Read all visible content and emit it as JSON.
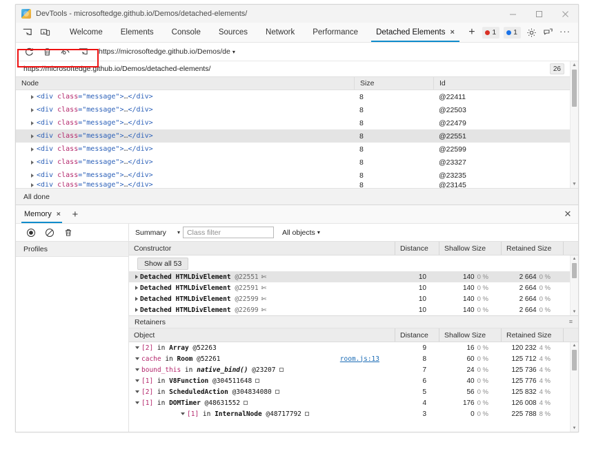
{
  "window": {
    "title": "DevTools - microsoftedge.github.io/Demos/detached-elements/",
    "favicon": "edge-devtools-icon",
    "controls": {
      "minimize": "minimize-icon",
      "maximize": "maximize-icon",
      "close": "close-icon"
    }
  },
  "main_tabs": {
    "left_icons": [
      "inspect-element-icon",
      "device-emulation-icon"
    ],
    "items": [
      {
        "label": "Welcome",
        "active": false
      },
      {
        "label": "Elements",
        "active": false
      },
      {
        "label": "Console",
        "active": false
      },
      {
        "label": "Sources",
        "active": false
      },
      {
        "label": "Network",
        "active": false
      },
      {
        "label": "Performance",
        "active": false
      },
      {
        "label": "Detached Elements",
        "active": true,
        "close": "×"
      }
    ],
    "add_tab": "+",
    "badges": [
      {
        "name": "error-badge",
        "count": "1",
        "color": "#d93025"
      },
      {
        "name": "info-badge",
        "count": "1",
        "color": "#1a73e8"
      }
    ],
    "right_icons": [
      "gear-icon",
      "feedback-icon"
    ],
    "more": "···"
  },
  "detached_toolbar": {
    "tools": [
      "refresh-icon",
      "delete-icon",
      "detach-eye-icon",
      "target-window-icon"
    ],
    "target": "https://microsoftedge.github.io/Demos/de",
    "caret": "▾",
    "annotation": "red-highlight-box"
  },
  "detached_panel": {
    "url": "https://microsoftedge.github.io/Demos/detached-elements/",
    "count": "26",
    "columns": [
      "Node",
      "Size",
      "Id"
    ],
    "rows": [
      {
        "node": "<div class=\"message\">…</div>",
        "size": "8",
        "id": "@22411",
        "selected": false
      },
      {
        "node": "<div class=\"message\">…</div>",
        "size": "8",
        "id": "@22503",
        "selected": false
      },
      {
        "node": "<div class=\"message\">…</div>",
        "size": "8",
        "id": "@22479",
        "selected": false
      },
      {
        "node": "<div class=\"message\">…</div>",
        "size": "8",
        "id": "@22551",
        "selected": true
      },
      {
        "node": "<div class=\"message\">…</div>",
        "size": "8",
        "id": "@22599",
        "selected": false
      },
      {
        "node": "<div class=\"message\">…</div>",
        "size": "8",
        "id": "@23327",
        "selected": false
      },
      {
        "node": "<div class=\"message\">…</div>",
        "size": "8",
        "id": "@23235",
        "selected": false
      },
      {
        "node": "<div class=\"message\">…</div>",
        "size": "8",
        "id": "@23145",
        "selected": false
      }
    ],
    "status": "All done"
  },
  "drawer": {
    "tabs": [
      {
        "label": "Memory",
        "active": true,
        "close": "×"
      }
    ],
    "add_tab": "+",
    "close": "✕"
  },
  "memory": {
    "toolbar_icons": [
      "record-icon",
      "clear-icon",
      "delete-icon"
    ],
    "view_select": "Summary",
    "view_caret": "▾",
    "class_filter_placeholder": "Class filter",
    "class_filter_value": "",
    "objects_select": "All objects",
    "objects_caret": "▾",
    "profiles_header": "Profiles",
    "constructor_columns": [
      "Constructor",
      "Distance",
      "Shallow Size",
      "Retained Size"
    ],
    "show_all_label": "Show all 53",
    "constructor_rows": [
      {
        "prefix": "Detached",
        "ctor": "HTMLDivElement",
        "id": "@22551",
        "distance": "10",
        "shallow": "140",
        "shallow_pct": "0 %",
        "retained": "2 664",
        "retained_pct": "0 %",
        "selected": true
      },
      {
        "prefix": "Detached",
        "ctor": "HTMLDivElement",
        "id": "@22591",
        "distance": "10",
        "shallow": "140",
        "shallow_pct": "0 %",
        "retained": "2 664",
        "retained_pct": "0 %",
        "selected": false
      },
      {
        "prefix": "Detached",
        "ctor": "HTMLDivElement",
        "id": "@22599",
        "distance": "10",
        "shallow": "140",
        "shallow_pct": "0 %",
        "retained": "2 664",
        "retained_pct": "0 %",
        "selected": false
      },
      {
        "prefix": "Detached",
        "ctor": "HTMLDivElement",
        "id": "@22699",
        "distance": "10",
        "shallow": "140",
        "shallow_pct": "0 %",
        "retained": "2 664",
        "retained_pct": "0 %",
        "selected": false
      }
    ],
    "retainers_label": "Retainers",
    "retainers_columns": [
      "Object",
      "Distance",
      "Shallow Size",
      "Retained Size"
    ],
    "retainer_rows": [
      {
        "indent": 0,
        "index": "[2]",
        "in": "in",
        "name": "Array",
        "id": "@52263",
        "link": "",
        "distance": "9",
        "shallow": "16",
        "shallow_pct": "0 %",
        "retained": "120 232",
        "retained_pct": "4 %",
        "italic": false,
        "box": false
      },
      {
        "indent": 1,
        "index": "cache",
        "in": "in",
        "name": "Room",
        "id": "@52261",
        "link": "room.js:13",
        "distance": "8",
        "shallow": "60",
        "shallow_pct": "0 %",
        "retained": "125 712",
        "retained_pct": "4 %",
        "italic": false,
        "box": false
      },
      {
        "indent": 2,
        "index": "bound_this",
        "in": "in",
        "name": "native_bind()",
        "id": "@23207",
        "link": "",
        "distance": "7",
        "shallow": "24",
        "shallow_pct": "0 %",
        "retained": "125 736",
        "retained_pct": "4 %",
        "italic": true,
        "box": true
      },
      {
        "indent": 3,
        "index": "[1]",
        "in": "in",
        "name": "V8Function",
        "id": "@304511648",
        "link": "",
        "distance": "6",
        "shallow": "40",
        "shallow_pct": "0 %",
        "retained": "125 776",
        "retained_pct": "4 %",
        "italic": false,
        "box": true
      },
      {
        "indent": 4,
        "index": "[2]",
        "in": "in",
        "name": "ScheduledAction",
        "id": "@304834080",
        "link": "",
        "distance": "5",
        "shallow": "56",
        "shallow_pct": "0 %",
        "retained": "125 832",
        "retained_pct": "4 %",
        "italic": false,
        "box": true
      },
      {
        "indent": 5,
        "index": "[1]",
        "in": "in",
        "name": "DOMTimer",
        "id": "@48631552",
        "link": "",
        "distance": "4",
        "shallow": "176",
        "shallow_pct": "0 %",
        "retained": "126 008",
        "retained_pct": "4 %",
        "italic": false,
        "box": true
      },
      {
        "indent": 6,
        "index": "[1]",
        "in": "in",
        "name": "InternalNode",
        "id": "@48717792",
        "link": "",
        "distance": "3",
        "shallow": "0",
        "shallow_pct": "0 %",
        "retained": "225 788",
        "retained_pct": "8 %",
        "italic": false,
        "box": true
      }
    ]
  },
  "colors": {
    "accent": "#0f8ccc",
    "error": "#d93025",
    "info": "#1a73e8",
    "annotation": "#ee1111",
    "selection": "#e4e4e4",
    "tag": "#2a5fb8",
    "attr": "#b3266b",
    "link": "#1a6bb5"
  }
}
